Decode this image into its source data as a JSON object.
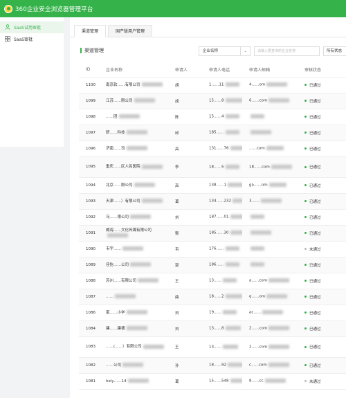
{
  "app": {
    "title": "360企业安全浏览器管理平台"
  },
  "sidebar": {
    "items": [
      {
        "label": "SaaS试用审批",
        "active": true,
        "icon": "user-icon"
      },
      {
        "label": "SaaS审批",
        "active": false,
        "icon": "grid-icon"
      }
    ]
  },
  "tabs": [
    {
      "label": "渠道管理",
      "active": true
    },
    {
      "label": "国产版用户管理",
      "active": false
    }
  ],
  "section": {
    "title": "渠道管理"
  },
  "filters": {
    "field_select": "企业名称",
    "search_placeholder": "请输入要查询的企业名称",
    "status_select": "所有状态"
  },
  "table": {
    "headers": [
      "ID",
      "企业名称",
      "申请人",
      "申请人电话",
      "申请人邮箱",
      "审核状态"
    ],
    "rows": [
      {
        "id": "1100",
        "company": "南京软……有限公司",
        "applicant": "胡",
        "phone": "1……11",
        "email": "4……om",
        "status": "已通过"
      },
      {
        "id": "1099",
        "company": "江苏……限公司",
        "applicant": "成",
        "phone": "15……8",
        "email": "6……com",
        "status": "已通过"
      },
      {
        "id": "1098",
        "company": "……团",
        "applicant": "陈",
        "phone": "15……4",
        "email": "",
        "status": "已通过"
      },
      {
        "id": "1097",
        "company": "舒……科技",
        "applicant": "邱",
        "phone": "185……",
        "email": "",
        "status": "已通过"
      },
      {
        "id": "1096",
        "company": "济南……司",
        "applicant": "高",
        "phone": "131……76",
        "email": "……com",
        "status": "已通过"
      },
      {
        "id": "1095",
        "company": "重庆……区人民医院",
        "applicant": "李",
        "phone": "18……5",
        "email": "18……com",
        "status": "已通过"
      },
      {
        "id": "1094",
        "company": "北京……限公司",
        "applicant": "高",
        "phone": "138……1",
        "email": "ga……om",
        "status": "已通过"
      },
      {
        "id": "1093",
        "company": "天津……）有限公司",
        "applicant": "葛",
        "phone": "134……232",
        "email": "3……",
        "status": "已通过"
      },
      {
        "id": "1092",
        "company": "乌……限公司",
        "applicant": "刘",
        "phone": "187……01",
        "email": "",
        "status": "已通过"
      },
      {
        "id": "1091",
        "company": "威海……文化传媒有限公司",
        "applicant": "郁",
        "phone": "185……30",
        "email": "",
        "status": "已通过"
      },
      {
        "id": "1090",
        "company": "韦宇……",
        "applicant": "韦",
        "phone": "176……",
        "email": "",
        "status": "未通过"
      },
      {
        "id": "1089",
        "company": "佳怡……公司",
        "applicant": "郭",
        "phone": "186……",
        "email": "",
        "status": "已通过"
      },
      {
        "id": "1088",
        "company": "苏州……有限公司",
        "applicant": "王",
        "phone": "13……",
        "email": "a……com",
        "status": "已通过"
      },
      {
        "id": "1087",
        "company": "……",
        "applicant": "曲",
        "phone": "18……2",
        "email": "q……om",
        "status": "已通过"
      },
      {
        "id": "1086",
        "company": "南……小学",
        "applicant": "刘",
        "phone": "19……",
        "email": "ac……",
        "status": "已通过"
      },
      {
        "id": "1084",
        "company": "建……建德",
        "applicant": "刘",
        "phone": "13……8",
        "email": "2……com",
        "status": "已通过"
      },
      {
        "id": "1083",
        "company": "……(……）有限公司",
        "applicant": "王",
        "phone": "13……",
        "email": "2……com",
        "status": "已通过"
      },
      {
        "id": "1082",
        "company": "……公司",
        "applicant": "孙",
        "phone": "18……92",
        "email": "c……com",
        "status": "已通过"
      },
      {
        "id": "1081",
        "company": "hely……14",
        "applicant": "葛",
        "phone": "15……548",
        "email": "8……cc",
        "status": "未通过"
      }
    ]
  },
  "colors": {
    "accent": "#35b34a",
    "approved_dot": "#35b34a",
    "rejected_dot": "#bbbbbb"
  }
}
